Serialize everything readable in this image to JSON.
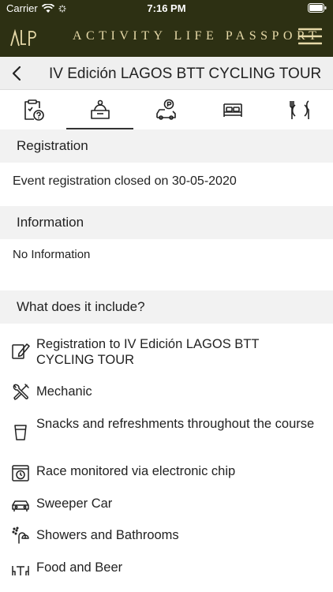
{
  "status_bar": {
    "carrier": "Carrier",
    "time": "7:16 PM"
  },
  "header": {
    "app_title": "ACTIVITY LIFE PASSPORT",
    "brand_color": "#2d3013",
    "title_color": "#e6d9a8"
  },
  "nav": {
    "title": "IV Edición LAGOS BTT CYCLING TOUR"
  },
  "tabs": [
    {
      "name": "info-tab",
      "icon": "clipboard-question-icon"
    },
    {
      "name": "registration-tab",
      "icon": "reception-desk-icon",
      "active": true
    },
    {
      "name": "parking-tab",
      "icon": "car-parking-icon"
    },
    {
      "name": "accommodation-tab",
      "icon": "bed-icon"
    },
    {
      "name": "restaurants-tab",
      "icon": "plate-cutlery-icon"
    }
  ],
  "sections": {
    "registration": {
      "title": "Registration",
      "text": "Event registration closed on 30-05-2020"
    },
    "information": {
      "title": "Information",
      "text": "No Information"
    },
    "includes": {
      "title": "What does it include?",
      "items": [
        {
          "label": "Registration to IV Edición LAGOS BTT CYCLING TOUR",
          "icon": "pencil-form-icon"
        },
        {
          "label": "Mechanic",
          "icon": "wrench-screwdriver-icon"
        },
        {
          "label": "Snacks and refreshments throughout the course",
          "icon": "cup-icon"
        },
        {
          "label": "Race monitored via electronic chip",
          "icon": "chip-timer-icon"
        },
        {
          "label": "Sweeper Car",
          "icon": "car-icon"
        },
        {
          "label": "Showers and Bathrooms",
          "icon": "shower-icon"
        },
        {
          "label": "Food and Beer",
          "icon": "table-chairs-icon"
        }
      ]
    }
  }
}
